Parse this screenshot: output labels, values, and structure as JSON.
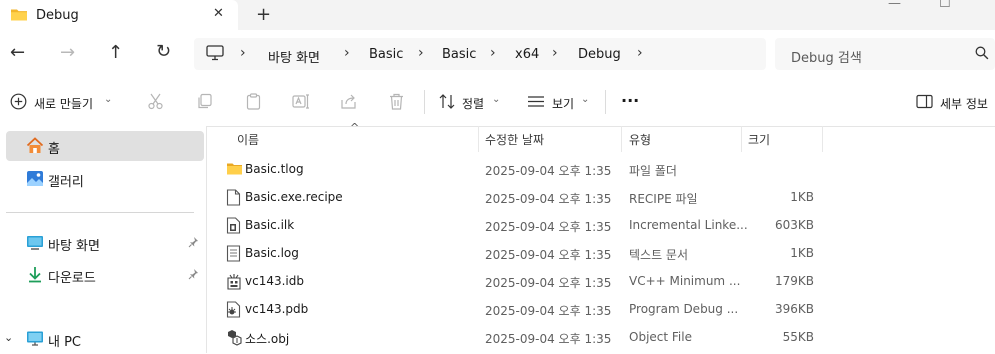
{
  "tab": {
    "title": "Debug",
    "close": "✕",
    "add": "+"
  },
  "window": {
    "minimize": "—",
    "maximize": "☐"
  },
  "nav": {
    "back": "←",
    "forward": "→",
    "up": "↑",
    "refresh": "↻"
  },
  "breadcrumb": [
    "바탕 화면",
    "Basic",
    "Basic",
    "x64",
    "Debug"
  ],
  "search": {
    "placeholder": "Debug 검색"
  },
  "toolbar": {
    "new_label": "새로 만들기",
    "sort_label": "정렬",
    "view_label": "보기",
    "more": "···",
    "details_label": "세부 정보"
  },
  "sidebar": {
    "items": [
      {
        "label": "홈",
        "icon": "home-icon"
      },
      {
        "label": "갤러리",
        "icon": "gallery-icon"
      },
      {
        "label": "바탕 화면",
        "icon": "desktop-icon"
      },
      {
        "label": "다운로드",
        "icon": "download-icon"
      },
      {
        "label": "내 PC",
        "icon": "pc-icon"
      }
    ]
  },
  "columns": {
    "name": "이름",
    "date": "수정한 날짜",
    "type": "유형",
    "size": "크기"
  },
  "files": [
    {
      "name": "Basic.tlog",
      "date": "2025-09-04 오후 1:35",
      "type": "파일 폴더",
      "size": "",
      "icon": "folder-icon"
    },
    {
      "name": "Basic.exe.recipe",
      "date": "2025-09-04 오후 1:35",
      "type": "RECIPE 파일",
      "size": "1KB",
      "icon": "file-icon"
    },
    {
      "name": "Basic.ilk",
      "date": "2025-09-04 오후 1:35",
      "type": "Incremental Linke...",
      "size": "603KB",
      "icon": "ilk-file-icon"
    },
    {
      "name": "Basic.log",
      "date": "2025-09-04 오후 1:35",
      "type": "텍스트 문서",
      "size": "1KB",
      "icon": "text-file-icon"
    },
    {
      "name": "vc143.idb",
      "date": "2025-09-04 오후 1:35",
      "type": "VC++ Minimum ...",
      "size": "179KB",
      "icon": "idb-file-icon"
    },
    {
      "name": "vc143.pdb",
      "date": "2025-09-04 오후 1:35",
      "type": "Program Debug ...",
      "size": "396KB",
      "icon": "pdb-file-icon"
    },
    {
      "name": "소스.obj",
      "date": "2025-09-04 오후 1:35",
      "type": "Object File",
      "size": "55KB",
      "icon": "obj-file-icon"
    }
  ]
}
